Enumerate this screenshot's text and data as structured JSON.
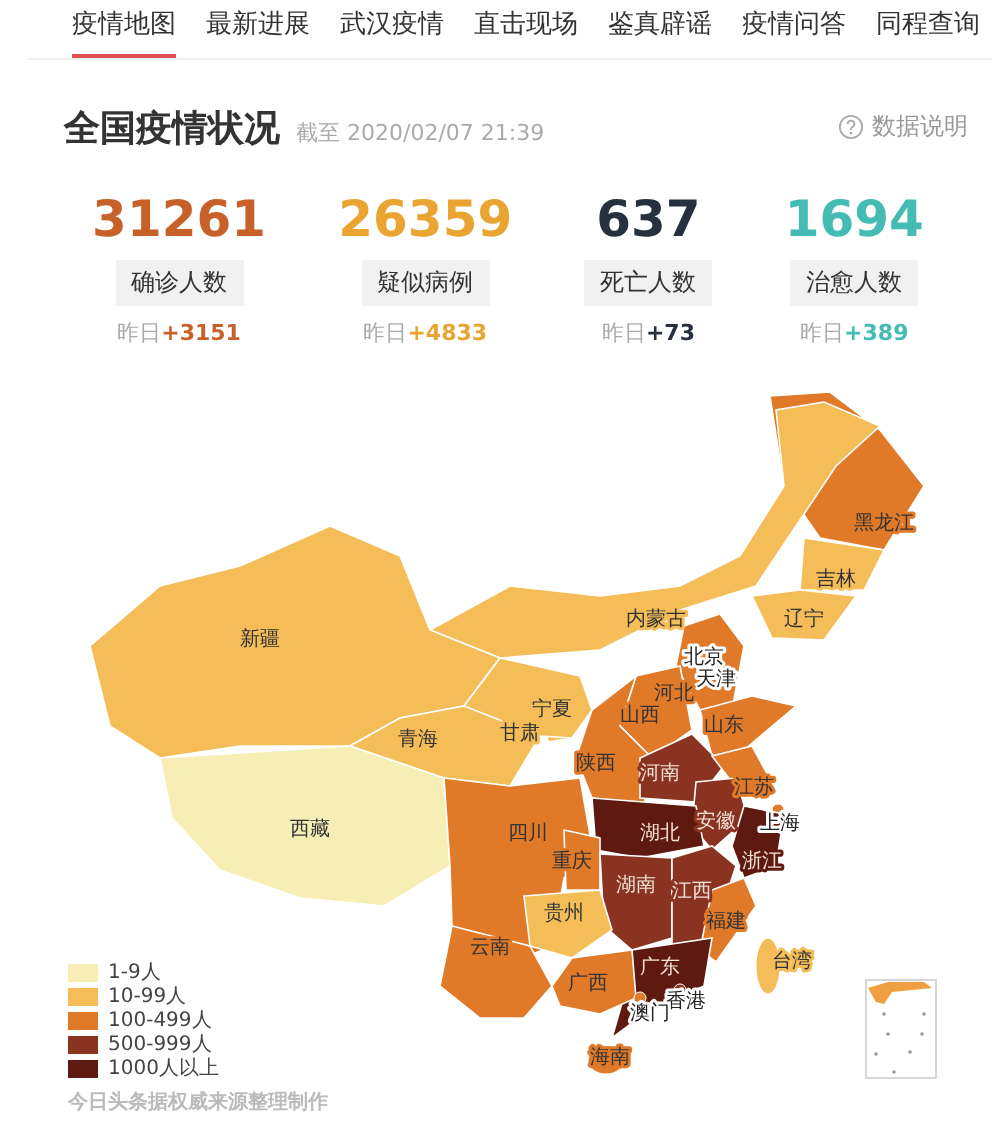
{
  "tabs": [
    {
      "label": "疫情地图",
      "selected": true
    },
    {
      "label": "最新进展",
      "selected": false
    },
    {
      "label": "武汉疫情",
      "selected": false
    },
    {
      "label": "直击现场",
      "selected": false
    },
    {
      "label": "鉴真辟谣",
      "selected": false
    },
    {
      "label": "疫情问答",
      "selected": false
    },
    {
      "label": "同程查询",
      "selected": false
    }
  ],
  "header": {
    "title": "全国疫情状况",
    "timestamp": "截至 2020/02/07 21:39",
    "help_link": "数据说明"
  },
  "stats": [
    {
      "value": "31261",
      "label": "确诊人数",
      "yesterday_label": "昨日",
      "change": "+3151",
      "color": "#c8602a"
    },
    {
      "value": "26359",
      "label": "疑似病例",
      "yesterday_label": "昨日",
      "change": "+4833",
      "color": "#e9a431"
    },
    {
      "value": "637",
      "label": "死亡人数",
      "yesterday_label": "昨日",
      "change": "+73",
      "color": "#27313d"
    },
    {
      "value": "1694",
      "label": "治愈人数",
      "yesterday_label": "昨日",
      "change": "+389",
      "color": "#45bcb3"
    }
  ],
  "map": {
    "provinces": [
      {
        "name": "黑龙江",
        "color": "#e07a28"
      },
      {
        "name": "吉林",
        "color": "#f5bd58"
      },
      {
        "name": "内蒙古",
        "color": "#f5bd58"
      },
      {
        "name": "辽宁",
        "color": "#f5bd58"
      },
      {
        "name": "新疆",
        "color": "#f5bd58"
      },
      {
        "name": "北京",
        "color": "#e07a28"
      },
      {
        "name": "天津",
        "color": "#e07a28"
      },
      {
        "name": "河北",
        "color": "#e07a28"
      },
      {
        "name": "宁夏",
        "color": "#f5bd58"
      },
      {
        "name": "山西",
        "color": "#e07a28"
      },
      {
        "name": "山东",
        "color": "#e07a28"
      },
      {
        "name": "青海",
        "color": "#f5bd58"
      },
      {
        "name": "甘肃",
        "color": "#f5bd58"
      },
      {
        "name": "陕西",
        "color": "#e07a28"
      },
      {
        "name": "河南",
        "color": "#8a3320"
      },
      {
        "name": "江苏",
        "color": "#e07a28"
      },
      {
        "name": "西藏",
        "color": "#f7eeb5"
      },
      {
        "name": "安徽",
        "color": "#8a3320"
      },
      {
        "name": "上海",
        "color": "#e07a28"
      },
      {
        "name": "四川",
        "color": "#e07a28"
      },
      {
        "name": "湖北",
        "color": "#5e1a10"
      },
      {
        "name": "重庆",
        "color": "#e07a28"
      },
      {
        "name": "浙江",
        "color": "#5e1a10"
      },
      {
        "name": "湖南",
        "color": "#8a3320"
      },
      {
        "name": "江西",
        "color": "#8a3320"
      },
      {
        "name": "贵州",
        "color": "#f5bd58"
      },
      {
        "name": "福建",
        "color": "#e07a28"
      },
      {
        "name": "台湾",
        "color": "#f5bd58"
      },
      {
        "name": "云南",
        "color": "#e07a28"
      },
      {
        "name": "广东",
        "color": "#5e1a10"
      },
      {
        "name": "广西",
        "color": "#e07a28"
      },
      {
        "name": "香港",
        "color": "#8a3320"
      },
      {
        "name": "澳门",
        "color": "#e07a28"
      },
      {
        "name": "海南",
        "color": "#e07a28"
      }
    ],
    "legend": [
      {
        "label": "1-9人",
        "color": "#f7eeb5"
      },
      {
        "label": "10-99人",
        "color": "#f5bd58"
      },
      {
        "label": "100-499人",
        "color": "#e07a28"
      },
      {
        "label": "500-999人",
        "color": "#8a3320"
      },
      {
        "label": "1000人以上",
        "color": "#5e1a10"
      }
    ],
    "source_note": "今日头条据权威来源整理制作"
  }
}
